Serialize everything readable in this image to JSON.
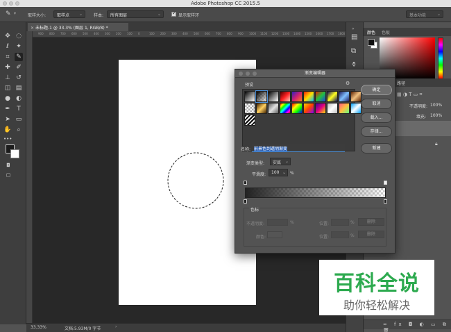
{
  "app": {
    "title": "Adobe Photoshop CC 2015.5",
    "workspace": "基本功能"
  },
  "options": {
    "sample_size_label": "取样大小:",
    "sample_size_value": "取样点",
    "sample_label": "样本:",
    "sample_value": "所有图层",
    "show_ring_label": "显示取样环"
  },
  "document": {
    "tab_title": "未标题-1 @ 33.3% (图层 1, RGB/8) *",
    "zoom": "33.33%",
    "doc_info": "文档:5.93M/0 字节"
  },
  "ruler": {
    "ticks": [
      "900",
      "800",
      "700",
      "600",
      "500",
      "400",
      "300",
      "200",
      "100",
      "0",
      "100",
      "200",
      "300",
      "400",
      "500",
      "600",
      "700",
      "800",
      "900",
      "1000",
      "1100",
      "1200",
      "1300",
      "1400",
      "1500",
      "1600",
      "1700",
      "1800"
    ]
  },
  "panels": {
    "color_tab": "颜色",
    "swatches_tab": "色板",
    "paths_tab": "路径",
    "opacity_label": "不透明度:",
    "opacity_value": "100%",
    "fill_label": "填充:",
    "fill_value": "100%"
  },
  "dialog": {
    "title": "渐变编辑器",
    "presets_label": "预设",
    "ok": "确定",
    "cancel": "取消",
    "load": "载入...",
    "save": "存储...",
    "new": "新建",
    "name_label": "名称:",
    "name_value": "前景色到透明渐变",
    "gradient_type_label": "渐变类型:",
    "gradient_type_value": "实底",
    "smoothness_label": "平滑度:",
    "smoothness_value": "100",
    "smoothness_unit": "%",
    "stops_label": "色标",
    "opacity_label": "不透明度:",
    "opacity_unit": "%",
    "location_label": "位置:",
    "location_unit": "%",
    "delete_label": "删除",
    "color_label": "颜色:",
    "preset_swatches": [
      "linear-gradient(135deg,#000,#fff)",
      "linear-gradient(135deg,#000,rgba(0,0,0,0)) , repeating-conic-gradient(#ccc 0% 25%,#fff 0% 50%) 0 0/5px 5px",
      "linear-gradient(135deg,#000,#fff)",
      "linear-gradient(135deg,#4a0000,#ff2020,#ffd0c0)",
      "linear-gradient(135deg,#3020c0,#d02070,#ff8020)",
      "linear-gradient(135deg,#ff2000,#ffe000,#00c0ff)",
      "linear-gradient(135deg,#e02000,#20c040,#2040e0)",
      "linear-gradient(135deg,#101060,#ffff20,#101060)",
      "linear-gradient(135deg,#202060,#80c0ff,#202060)",
      "linear-gradient(135deg,#5a2000,#f0c080,#5a2000)",
      "repeating-conic-gradient(#aaa 0% 25%,#fff 0% 50%) 0 0/5px 5px",
      "linear-gradient(135deg,#402000,#ffd060,#402000)",
      "linear-gradient(135deg,#606060,#e0e0e0,#606060)",
      "linear-gradient(135deg,#f00,#ff0,#0f0,#0ff,#00f,#f0f,#f00)",
      "linear-gradient(135deg,#f00,#ff0,#0f0,#00f)",
      "linear-gradient(135deg,#ffd000,#ff4000,#8000ff)",
      "linear-gradient(135deg,#4000a0,#e00080,#ffe000)",
      "linear-gradient(135deg,#c0c0c0,#fff,#c0c0c0)",
      "linear-gradient(135deg,#ff6080,#ffc040,#60ff80)",
      "linear-gradient(135deg,#00a0ff,#ffffff,#00a0ff)",
      "repeating-linear-gradient(135deg,#000 0 2px,#fff 2px 4px)"
    ]
  },
  "watermark": {
    "title": "百科全说",
    "subtitle": "助你轻松解决"
  }
}
